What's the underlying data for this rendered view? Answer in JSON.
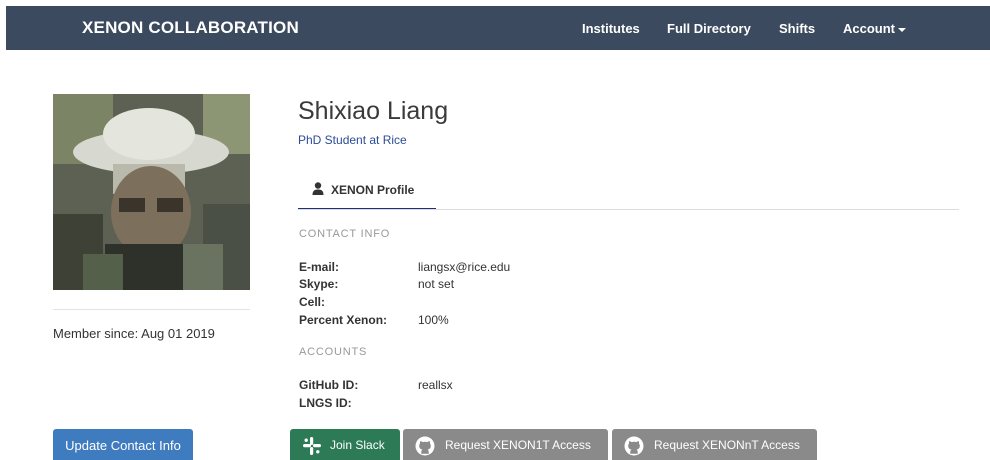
{
  "navbar": {
    "brand": "XENON COLLABORATION",
    "links": [
      "Institutes",
      "Full Directory",
      "Shifts"
    ],
    "account": "Account"
  },
  "profile": {
    "name": "Shixiao Liang",
    "role": "PhD Student at Rice",
    "member_since": "Member since: Aug 01 2019"
  },
  "tab": {
    "label": "XENON Profile"
  },
  "contact": {
    "heading": "CONTACT INFO",
    "fields": [
      {
        "label": "E-mail:",
        "value": "liangsx@rice.edu"
      },
      {
        "label": "Skype:",
        "value": "not set"
      },
      {
        "label": "Cell:",
        "value": ""
      },
      {
        "label": "Percent Xenon:",
        "value": "100%"
      }
    ]
  },
  "accounts": {
    "heading": "ACCOUNTS",
    "fields": [
      {
        "label": "GitHub ID:",
        "value": "reallsx"
      },
      {
        "label": "LNGS ID:",
        "value": ""
      }
    ]
  },
  "buttons": {
    "update": "Update Contact Info",
    "slack": "Join Slack",
    "xenon1t": "Request XENON1T Access",
    "xenonnt": "Request XENONnT Access"
  },
  "icons": {
    "profile_tab": "user-icon",
    "slack": "slack-icon",
    "github": "github-icon"
  },
  "colors": {
    "navbar": "#3b4a5f",
    "link_blue": "#2a4c95",
    "update_button": "#3f7bbf",
    "slack_button": "#2c7a56",
    "request_button": "#8a8a8a"
  }
}
